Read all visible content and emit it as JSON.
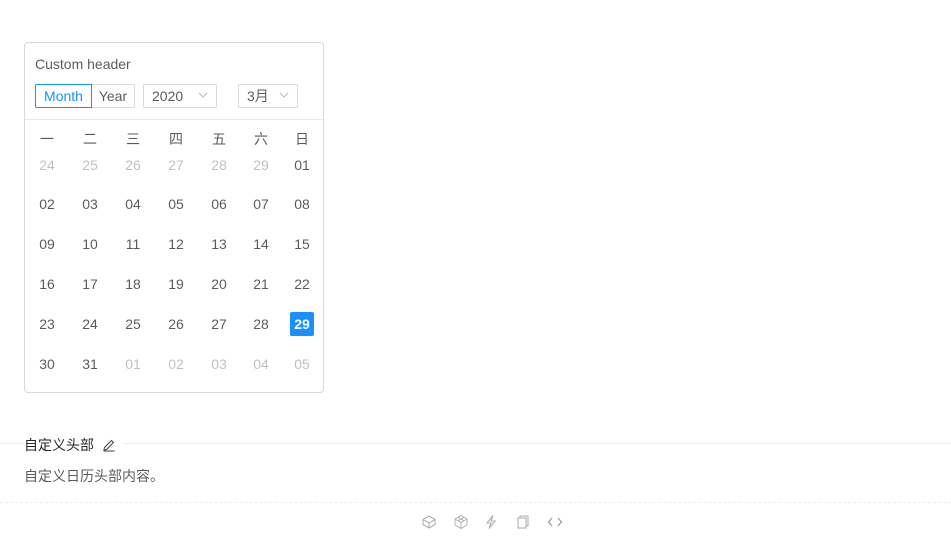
{
  "calendar": {
    "title": "Custom header",
    "mode_buttons": [
      "Month",
      "Year"
    ],
    "active_mode": "Month",
    "year_select": "2020",
    "month_select": "3月",
    "weekdays": [
      "一",
      "二",
      "三",
      "四",
      "五",
      "六",
      "日"
    ],
    "weeks": [
      [
        "24",
        "25",
        "26",
        "27",
        "28",
        "29",
        "01"
      ],
      [
        "02",
        "03",
        "04",
        "05",
        "06",
        "07",
        "08"
      ],
      [
        "09",
        "10",
        "11",
        "12",
        "13",
        "14",
        "15"
      ],
      [
        "16",
        "17",
        "18",
        "19",
        "20",
        "21",
        "22"
      ],
      [
        "23",
        "24",
        "25",
        "26",
        "27",
        "28",
        "29"
      ],
      [
        "30",
        "31",
        "01",
        "02",
        "03",
        "04",
        "05"
      ]
    ],
    "muted": [
      [
        true,
        true,
        true,
        true,
        true,
        true,
        false
      ],
      [
        false,
        false,
        false,
        false,
        false,
        false,
        false
      ],
      [
        false,
        false,
        false,
        false,
        false,
        false,
        false
      ],
      [
        false,
        false,
        false,
        false,
        false,
        false,
        false
      ],
      [
        false,
        false,
        false,
        false,
        false,
        false,
        false
      ],
      [
        false,
        false,
        true,
        true,
        true,
        true,
        true
      ]
    ],
    "selected_day": "29"
  },
  "meta": {
    "title": "自定义头部",
    "description": "自定义日历头部内容。"
  },
  "actions": [
    "codepen-icon",
    "codesandbox-icon",
    "thunderbolt-icon",
    "copy-icon",
    "code-expand-icon"
  ],
  "colors": {
    "accent": "#1890ff",
    "border": "#d9d9d9",
    "text": "rgba(0,0,0,0.65)",
    "muted_text": "rgba(0,0,0,0.25)"
  }
}
